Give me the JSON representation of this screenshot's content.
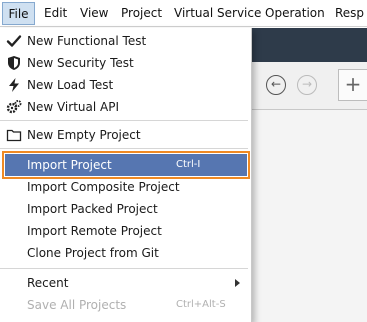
{
  "menubar": {
    "items": [
      "File",
      "Edit",
      "View",
      "Project",
      "Virtual Service",
      "Operation",
      "Resp"
    ]
  },
  "file_menu": {
    "group1": [
      {
        "label": "New Functional Test",
        "icon": "checkmark-icon"
      },
      {
        "label": "New Security Test",
        "icon": "shield-icon"
      },
      {
        "label": "New Load Test",
        "icon": "lightning-icon"
      },
      {
        "label": "New Virtual API",
        "icon": "gears-icon"
      }
    ],
    "group2": [
      {
        "label": "New Empty Project",
        "icon": "folder-icon"
      }
    ],
    "highlighted": {
      "label": "Import Project",
      "shortcut": "Ctrl-I"
    },
    "group3": [
      {
        "label": "Import Composite Project"
      },
      {
        "label": "Import Packed Project"
      },
      {
        "label": "Import Remote Project"
      },
      {
        "label": "Clone Project from Git"
      }
    ],
    "recent": {
      "label": "Recent"
    },
    "save_all": {
      "label": "Save All Projects",
      "shortcut": "Ctrl+Alt-S"
    }
  },
  "toolbar": {
    "back_glyph": "←",
    "forward_glyph": "→",
    "new_glyph": "+"
  },
  "colors": {
    "highlight_fill": "#5676b1",
    "highlight_border": "#f08a24",
    "dark_band": "#2e3b4a"
  }
}
